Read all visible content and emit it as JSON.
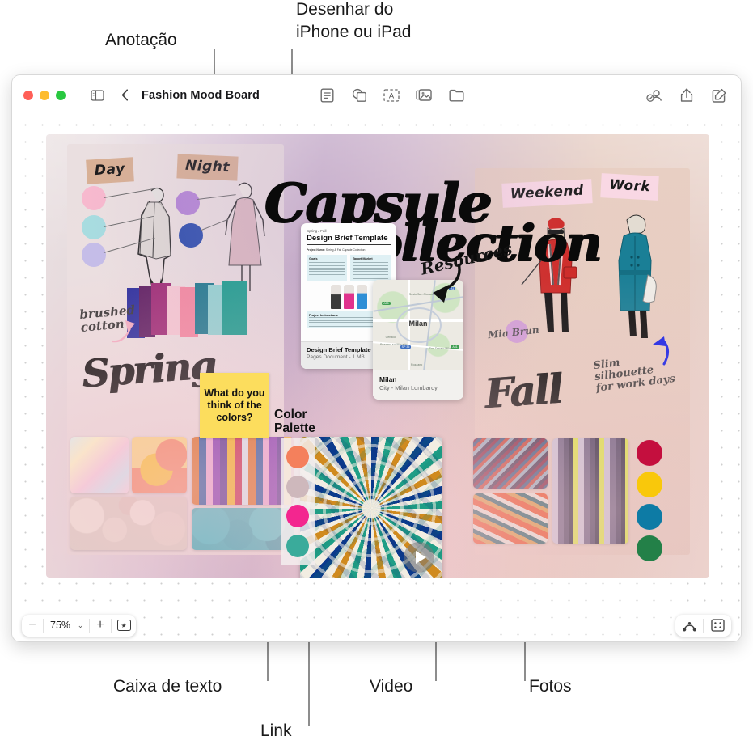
{
  "callouts": {
    "annotation": "Anotação",
    "draw": "Desenhar do\niPhone ou iPad",
    "textbox": "Caixa de texto",
    "link": "Link",
    "video": "Video",
    "photos": "Fotos"
  },
  "window": {
    "title": "Fashion Mood Board",
    "traffic_lights": [
      "close-red",
      "minimize-yellow",
      "zoom-green"
    ],
    "toolbar_left": [
      "sidebar-toggle-icon",
      "back-chevron-icon"
    ],
    "toolbar_center": [
      "note-icon",
      "shapes-icon",
      "text-box-icon",
      "media-icon",
      "folder-icon"
    ],
    "toolbar_right": [
      "collaborate-icon",
      "share-icon",
      "compose-icon"
    ]
  },
  "bottombar": {
    "zoom_minus": "−",
    "zoom_value": "75%",
    "zoom_chevron": "⌄",
    "zoom_plus": "+",
    "star": "★",
    "connector_icon": "connector-icon",
    "grid_icon": "grid-icon"
  },
  "board": {
    "title_line1": "Capsule",
    "title_line2": "Collection",
    "left_panel": {
      "tape_day": "Day",
      "tape_night": "Night",
      "fabric_note": "brushed\ncotton",
      "season": "Spring",
      "day_swatches": [
        "#f7b9ce",
        "#a8dce0",
        "#c5bde8"
      ],
      "night_swatches": [
        "#b486d6",
        "#2e4fae"
      ],
      "fabric_colors": [
        "#2b2f9e",
        "#7a2a6d",
        "#b5338e",
        "#f4c3cf",
        "#f48ba6",
        "#1c7f8e",
        "#8fd6d6",
        "#0f9e8b"
      ]
    },
    "right_panel": {
      "tape_weekend": "Weekend",
      "tape_work": "Work",
      "season": "Fall",
      "note_slim": "Slim\nsilhouette\nfor work days",
      "signature": "Mia Brun",
      "accent_swatch": "#d3a0d8"
    },
    "annotation_resources": "Resources",
    "sticky_note": "What do you think of the colors?",
    "palette_label": "Color\nPalette",
    "palette_colors": [
      "#f4805c",
      "#ceb8bc",
      "#f3268f",
      "#3aab9b"
    ],
    "fall_colors": [
      "#c40f3e",
      "#f9c80b",
      "#0d7ba5",
      "#238048"
    ],
    "document": {
      "kicker": "Spring / Fall",
      "heading": "Design Brief Template",
      "project_label": "Project Name:",
      "project_value": "Spring & Fall Capsule Collection",
      "col1_title": "Goals",
      "col2_title": "Target Market",
      "section_title": "Project Instructions",
      "filename": "Design Brief Template",
      "filemeta": "Pages Document - 1 MB"
    },
    "map": {
      "city": "Milan",
      "name": "Milan",
      "subtitle": "City - Milan Lombardy",
      "labels": [
        "Sesto San Giovanni",
        "Cerbico",
        "Pozzano sul Mayado",
        "San Donato Milanese",
        "Rozzano"
      ],
      "shields": [
        "A55",
        "A51",
        "A1",
        "SP 35"
      ]
    }
  }
}
